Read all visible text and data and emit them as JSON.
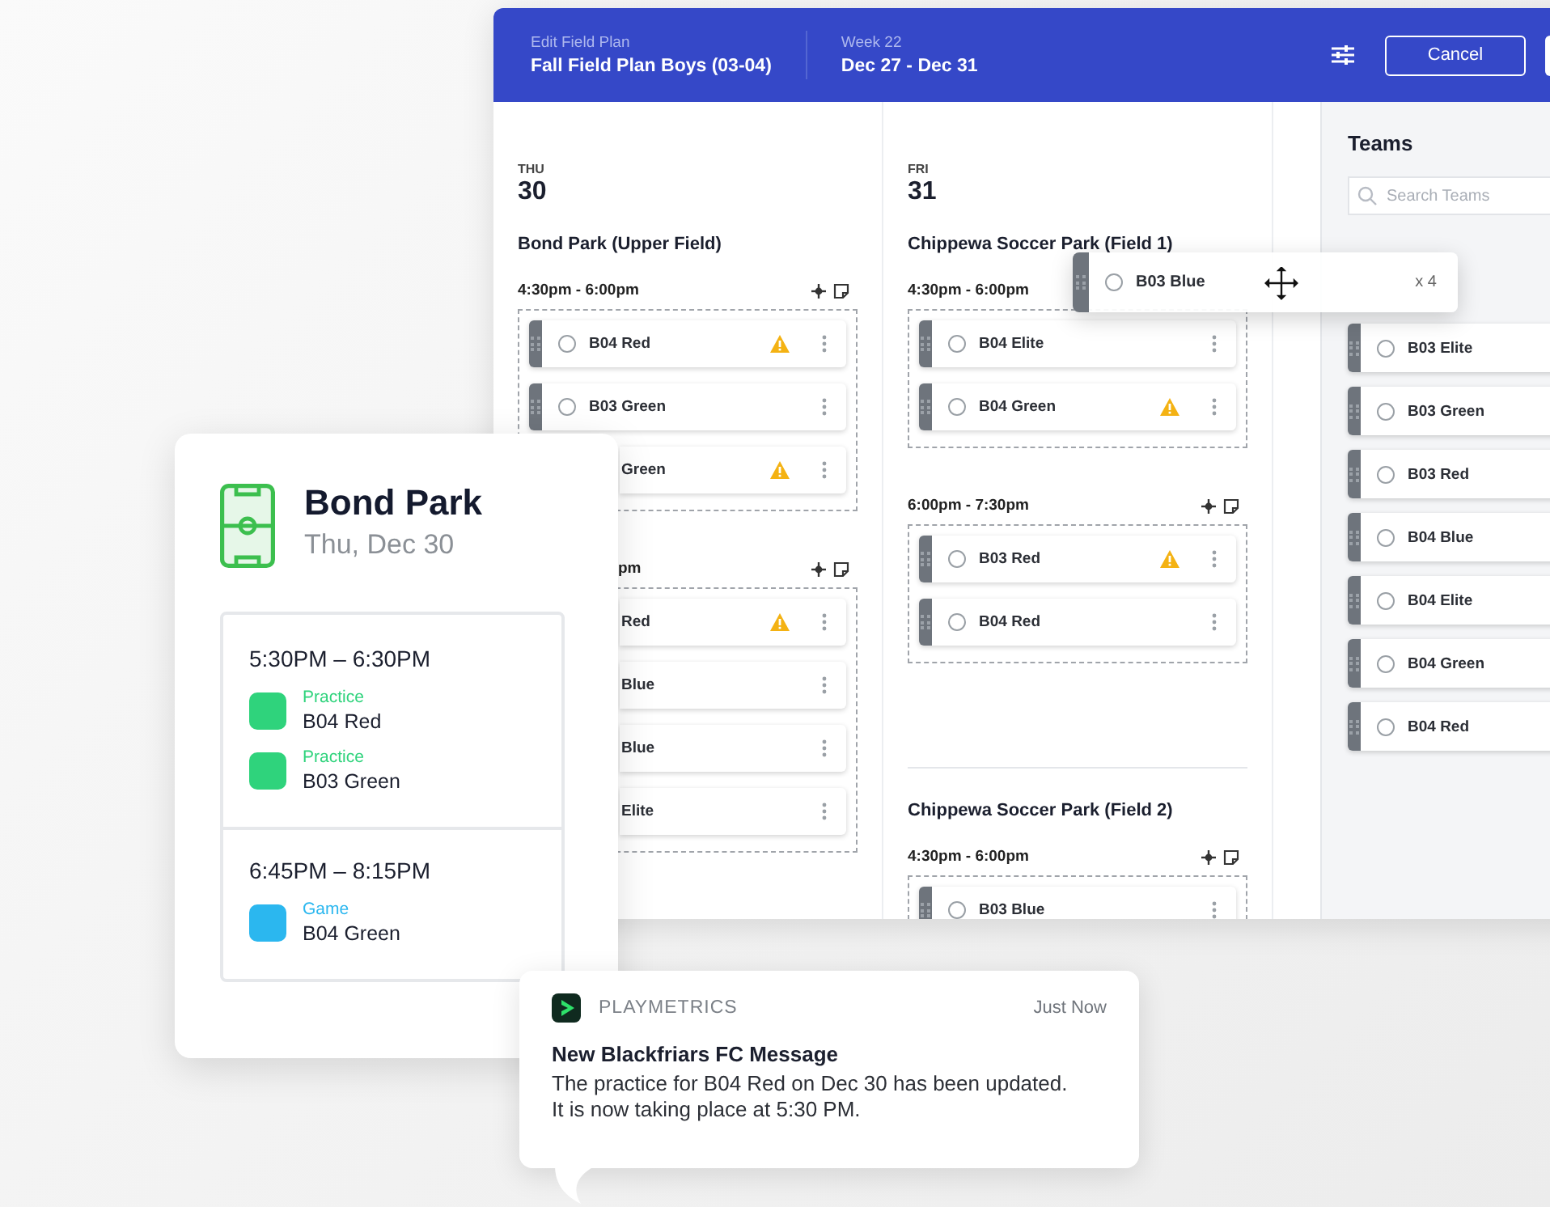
{
  "header": {
    "subtitle": "Edit Field Plan",
    "title": "Fall Field Plan Boys (03-04)",
    "week_label": "Week 22",
    "week_range": "Dec 27 - Dec 31",
    "cancel": "Cancel"
  },
  "days": [
    {
      "weekday": "THU",
      "day": "30",
      "venues": [
        {
          "name": "Bond Park (Upper Field)",
          "slots": [
            {
              "time": "4:30pm - 6:00pm",
              "clipped": false,
              "tools": true,
              "teams": [
                {
                  "name": "B04 Red",
                  "warning": true,
                  "clipped": false,
                  "checked": false
                },
                {
                  "name": "B03 Green",
                  "warning": false,
                  "clipped": false,
                  "checked": false
                },
                {
                  "name": "Green",
                  "warning": true,
                  "clipped": true
                }
              ]
            },
            {
              "time": "pm",
              "clipped": true,
              "tools": true,
              "teams": [
                {
                  "name": "Red",
                  "warning": true,
                  "clipped": true
                },
                {
                  "name": "Blue",
                  "warning": false,
                  "clipped": true
                },
                {
                  "name": "Blue",
                  "warning": false,
                  "clipped": true
                },
                {
                  "name": "Elite",
                  "warning": false,
                  "clipped": true
                }
              ]
            }
          ]
        }
      ]
    },
    {
      "weekday": "FRI",
      "day": "31",
      "venues": [
        {
          "name": "Chippewa Soccer Park (Field 1)",
          "slots": [
            {
              "time": "4:30pm - 6:00pm",
              "clipped": false,
              "tools": false,
              "teams": [
                {
                  "name": "B04 Elite",
                  "warning": false,
                  "clipped": false,
                  "checked": false
                },
                {
                  "name": "B04 Green",
                  "warning": true,
                  "clipped": false,
                  "checked": false
                }
              ]
            },
            {
              "time": "6:00pm - 7:30pm",
              "clipped": false,
              "tools": true,
              "teams": [
                {
                  "name": "B03 Red",
                  "warning": true,
                  "clipped": false,
                  "checked": false
                },
                {
                  "name": "B04 Red",
                  "warning": false,
                  "clipped": false,
                  "checked": false
                }
              ]
            }
          ]
        },
        {
          "name": "Chippewa Soccer Park (Field 2)",
          "slots": [
            {
              "time": "4:30pm - 6:00pm",
              "clipped": false,
              "tools": true,
              "teams": [
                {
                  "name": "B03 Blue",
                  "warning": false,
                  "clipped": false,
                  "checked": false
                }
              ]
            }
          ]
        }
      ]
    }
  ],
  "teams_panel": {
    "title": "Teams",
    "search": {
      "placeholder": "Search Teams"
    },
    "teams": [
      {
        "name": "B03 Elite",
        "checked": false
      },
      {
        "name": "B03 Green",
        "checked": false
      },
      {
        "name": "B03 Red",
        "checked": false
      },
      {
        "name": "B04 Blue",
        "checked": false
      },
      {
        "name": "B04 Elite",
        "checked": false
      },
      {
        "name": "B04 Green",
        "checked": false
      },
      {
        "name": "B04 Red",
        "checked": false
      }
    ]
  },
  "drag_ghost": {
    "team": "B03 Blue",
    "count": "x 4",
    "checked": false
  },
  "venue_card": {
    "name": "Bond Park",
    "date": "Thu, Dec 30",
    "groups": [
      {
        "time": "5:30PM – 6:30PM",
        "events": [
          {
            "type": "Practice",
            "team": "B04 Red",
            "color": "#2fd37c"
          },
          {
            "type": "Practice",
            "team": "B03 Green",
            "color": "#2fd37c"
          }
        ]
      },
      {
        "time": "6:45PM – 8:15PM",
        "events": [
          {
            "type": "Game",
            "team": "B04 Green",
            "color": "#2bb7ef"
          }
        ]
      }
    ]
  },
  "notification": {
    "app": "PLAYMETRICS",
    "time": "Just Now",
    "title": "New Blackfriars FC Message",
    "body": "The practice for B04 Red on Dec 30 has been updated. It is now taking place at 5:30 PM."
  }
}
